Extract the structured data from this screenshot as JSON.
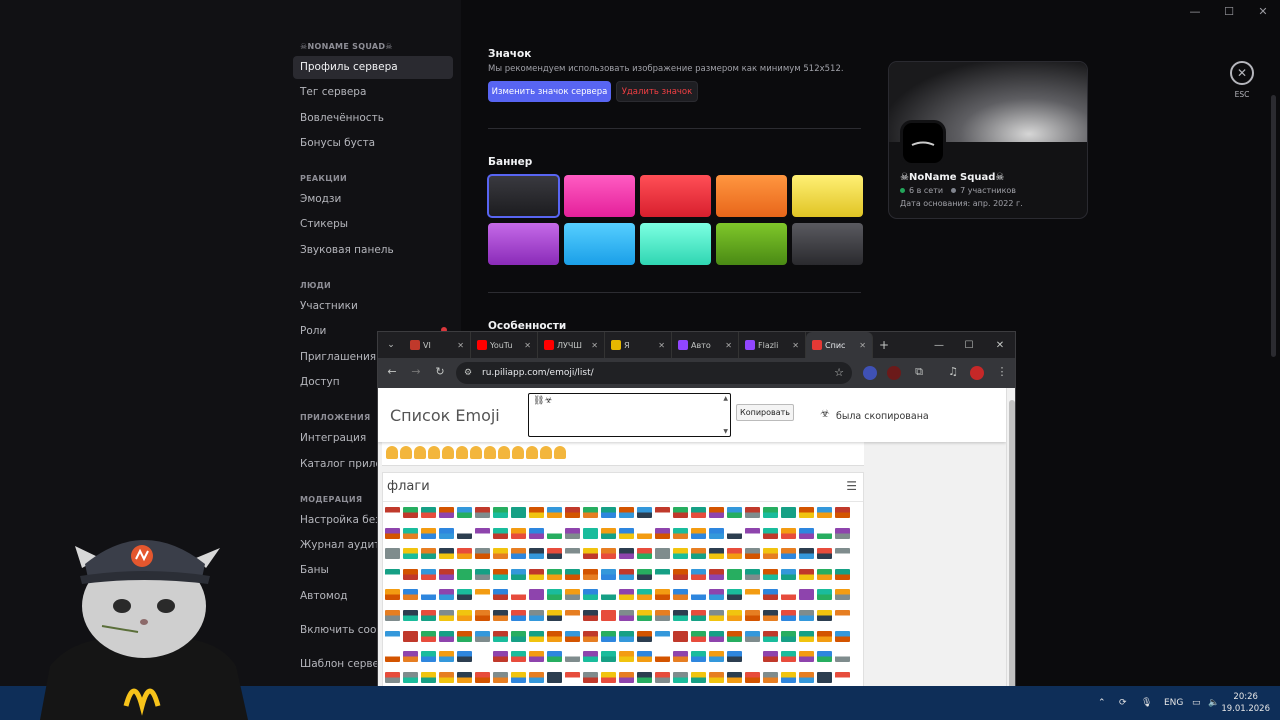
{
  "window_controls": [
    "—",
    "☐",
    "✕"
  ],
  "sidebar": {
    "server_name": "☠NONAME SQUAD☠",
    "groups": [
      {
        "header": "",
        "items": [
          {
            "label": "Профиль сервера",
            "active": true
          },
          {
            "label": "Тег сервера"
          },
          {
            "label": "Вовлечённость"
          },
          {
            "label": "Бонусы буста"
          }
        ]
      },
      {
        "header": "РЕАКЦИИ",
        "items": [
          {
            "label": "Эмодзи"
          },
          {
            "label": "Стикеры"
          },
          {
            "label": "Звуковая панель"
          }
        ]
      },
      {
        "header": "ЛЮДИ",
        "items": [
          {
            "label": "Участники"
          },
          {
            "label": "Роли",
            "badge": true
          },
          {
            "label": "Приглашения"
          },
          {
            "label": "Доступ"
          }
        ]
      },
      {
        "header": "ПРИЛОЖЕНИЯ",
        "items": [
          {
            "label": "Интеграция"
          },
          {
            "label": "Каталог прилож"
          }
        ]
      },
      {
        "header": "МОДЕРАЦИЯ",
        "items": [
          {
            "label": "Настройка безо"
          },
          {
            "label": "Журнал аудита"
          },
          {
            "label": "Баны"
          },
          {
            "label": "Автомод"
          }
        ]
      },
      {
        "header": "",
        "items": [
          {
            "label": "Включить сообщ"
          }
        ]
      },
      {
        "header": "",
        "items": [
          {
            "label": "Шаблон сервера"
          }
        ]
      }
    ]
  },
  "main": {
    "icon_title": "Значок",
    "icon_desc": "Мы рекомендуем использовать изображение размером как минимум 512x512.",
    "change_icon_label": "Изменить значок сервера",
    "delete_icon_label": "Удалить значок",
    "banner_title": "Баннер",
    "banner_colors": [
      [
        "#1c1c1f",
        "#3a3a40"
      ],
      [
        "#e4209a",
        "#ff5cc2"
      ],
      [
        "#d81f2e",
        "#ff4f56"
      ],
      [
        "#e8661a",
        "#ff9640"
      ],
      [
        "#e0c424",
        "#fff075"
      ],
      [
        "#8a2bb8",
        "#c56ae8"
      ],
      [
        "#1a9fe8",
        "#56cfff"
      ],
      [
        "#2fd6b2",
        "#7dffe2"
      ],
      [
        "#4a8a14",
        "#7fc72a"
      ],
      [
        "#2a2a2e",
        "#5a5a60"
      ]
    ],
    "features_title": "Особенности",
    "esc_label": "ESC",
    "preview": {
      "name": "☠NoName Squad☠",
      "online": "6 в сети",
      "members": "7 участников",
      "founded": "Дата основания: апр. 2022 г."
    }
  },
  "browser": {
    "tabs": [
      {
        "label": "VI",
        "color": "#c0392b",
        "active": false
      },
      {
        "label": "YouTu",
        "color": "#ff0000",
        "active": false
      },
      {
        "label": "ЛУЧШ",
        "color": "#ff0000",
        "active": false
      },
      {
        "label": "Я",
        "color": "#e6b800",
        "active": false
      },
      {
        "label": "Авто",
        "color": "#9146ff",
        "active": false
      },
      {
        "label": "Flazli",
        "color": "#9146ff",
        "active": false
      },
      {
        "label": "Спис",
        "color": "#e53935",
        "active": true
      }
    ],
    "new_tab": "+",
    "url": "ru.piliapp.com/emoji/list/",
    "page": {
      "title": "Список Emoji",
      "textarea_value": "⛓☣",
      "copy_label": "Копировать",
      "status": "была скопирована",
      "flags_title": "флаги",
      "flag_colors": [
        "#c0392b",
        "#2e86de",
        "#f1c40f",
        "#27ae60",
        "#ffffff",
        "#e67e22",
        "#16a085",
        "#8e44ad",
        "#2c3e50",
        "#d35400",
        "#1abc9c",
        "#e74c3c",
        "#3498db",
        "#f39c12",
        "#7f8c8d"
      ]
    }
  },
  "taskbar": {
    "lang": "ENG",
    "time": "20:26",
    "date": "19.01.2026"
  }
}
